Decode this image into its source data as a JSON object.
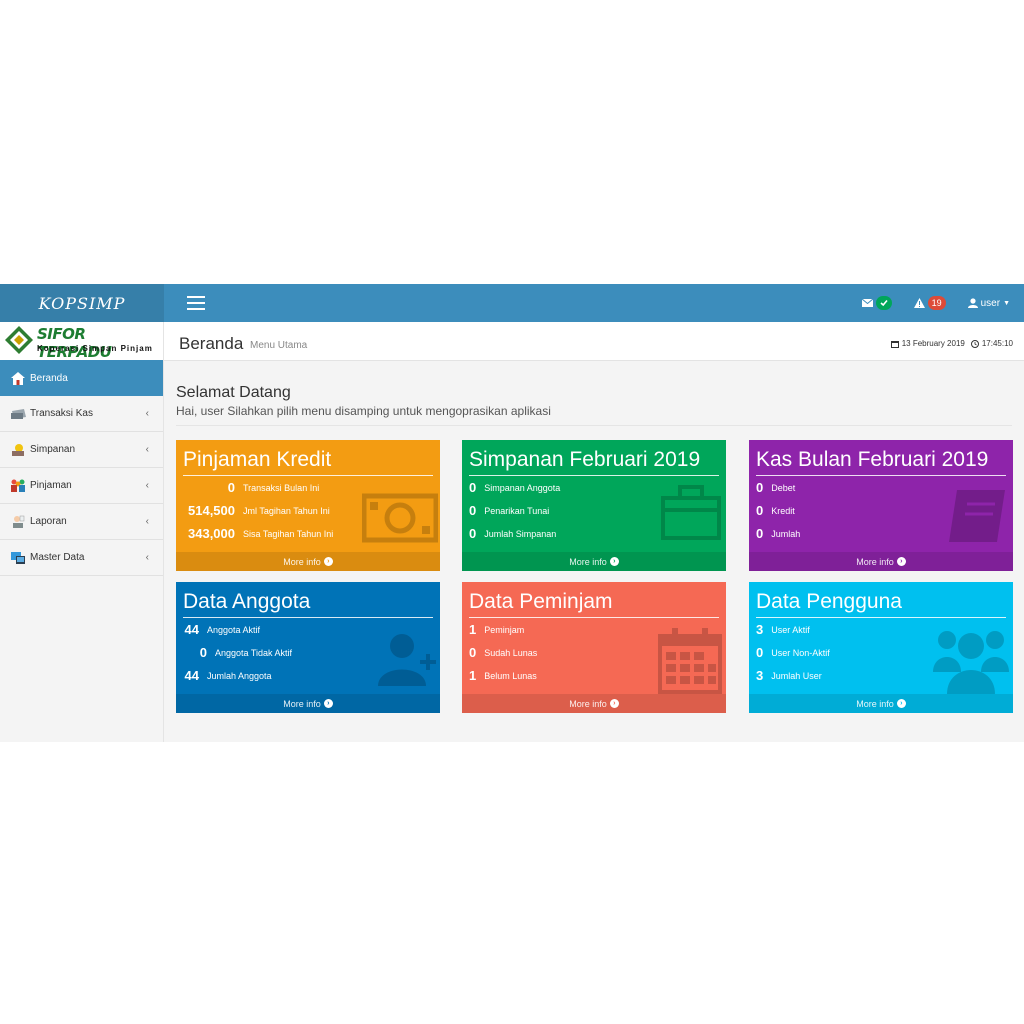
{
  "header": {
    "brand": "KOPSIMP",
    "messages_icon": "envelope-icon",
    "notif_count": "19",
    "user_label": "user"
  },
  "logo": {
    "title": "SIFOR TERPADU",
    "subtitle": "Koperasi Simpan Pinjam"
  },
  "sidebar": {
    "items": [
      {
        "label": "Beranda",
        "icon": "home-icon"
      },
      {
        "label": "Transaksi Kas",
        "icon": "cash-register-icon"
      },
      {
        "label": "Simpanan",
        "icon": "savings-icon"
      },
      {
        "label": "Pinjaman",
        "icon": "people-icon"
      },
      {
        "label": "Laporan",
        "icon": "report-icon"
      },
      {
        "label": "Master Data",
        "icon": "database-icon"
      }
    ]
  },
  "content": {
    "title": "Beranda",
    "subtitle": "Menu Utama",
    "date": "13 February 2019",
    "time": "17:45:10",
    "welcome_title": "Selamat Datang",
    "welcome_text": "Hai, user Silahkan pilih menu disamping untuk mengoprasikan aplikasi"
  },
  "boxes": [
    {
      "title": "Pinjaman Kredit",
      "color": "#f39c12",
      "rows": [
        {
          "value": "0",
          "label": "Transaksi Bulan Ini"
        },
        {
          "value": "514,500",
          "label": "Jml Tagihan Tahun Ini"
        },
        {
          "value": "343,000",
          "label": "Sisa Tagihan Tahun Ini"
        }
      ],
      "footer": "More info"
    },
    {
      "title": "Simpanan Februari 2019",
      "color": "#00a65a",
      "rows": [
        {
          "value": "0",
          "label": "Simpanan Anggota"
        },
        {
          "value": "0",
          "label": "Penarikan Tunai"
        },
        {
          "value": "0",
          "label": "Jumlah Simpanan"
        }
      ],
      "footer": "More info"
    },
    {
      "title": "Kas Bulan Februari 2019",
      "color": "#8e24aa",
      "rows": [
        {
          "value": "0",
          "label": "Debet"
        },
        {
          "value": "0",
          "label": "Kredit"
        },
        {
          "value": "0",
          "label": "Jumlah"
        }
      ],
      "footer": "More info"
    },
    {
      "title": "Data Anggota",
      "color": "#0073b7",
      "rows": [
        {
          "value": "44",
          "label": "Anggota Aktif"
        },
        {
          "value": "0",
          "label": "Anggota Tidak Aktif"
        },
        {
          "value": "44",
          "label": "Jumlah Anggota"
        }
      ],
      "footer": "More info"
    },
    {
      "title": "Data Peminjam",
      "color": "#f56954",
      "rows": [
        {
          "value": "1",
          "label": "Peminjam"
        },
        {
          "value": "0",
          "label": "Sudah Lunas"
        },
        {
          "value": "1",
          "label": "Belum Lunas"
        }
      ],
      "footer": "More info"
    },
    {
      "title": "Data Pengguna",
      "color": "#00c0ef",
      "rows": [
        {
          "value": "3",
          "label": "User Aktif"
        },
        {
          "value": "0",
          "label": "User Non-Aktif"
        },
        {
          "value": "3",
          "label": "Jumlah User"
        }
      ],
      "footer": "More info"
    }
  ]
}
